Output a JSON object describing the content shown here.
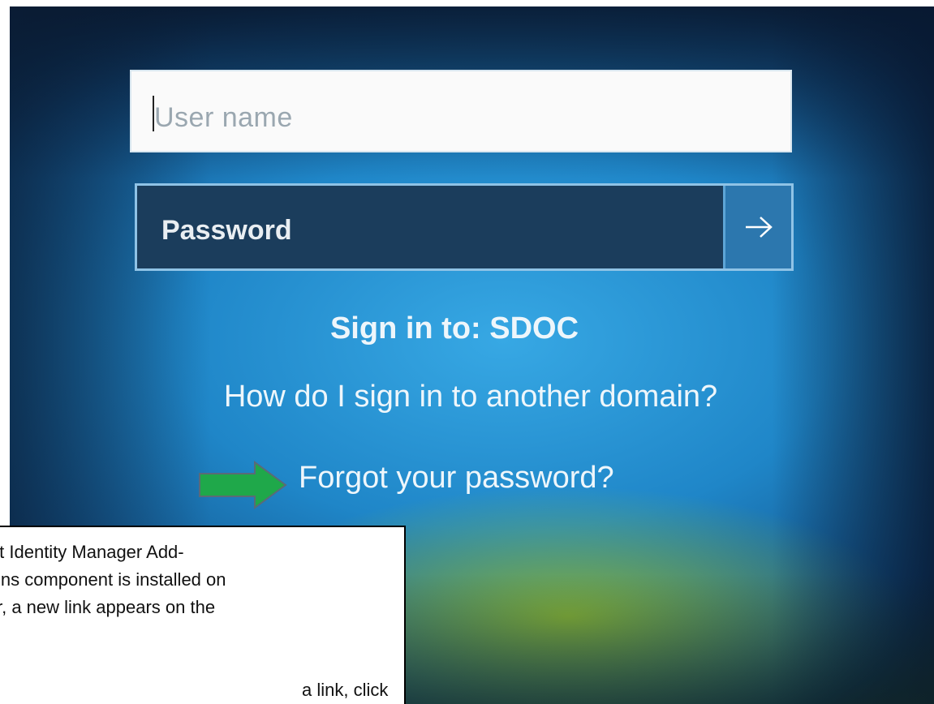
{
  "login": {
    "username_placeholder": "User name",
    "password_label": "Password",
    "submit_icon": "arrow-right-icon",
    "sign_in_to": "Sign in to: SDOC",
    "another_domain_link": "How do I sign in to another domain?",
    "forgot_password_link": "Forgot your password?"
  },
  "annotation": {
    "arrow_color": "#1fa84a",
    "caption_lines": [
      "Forefront Identity Manager Add-",
      "ins component is installed on",
      "r, a new link appears on the",
      "a link, click"
    ]
  },
  "colors": {
    "background_blue": "#1f86c8",
    "password_field": "#1b3d5c",
    "submit_button": "#2c77ae"
  }
}
